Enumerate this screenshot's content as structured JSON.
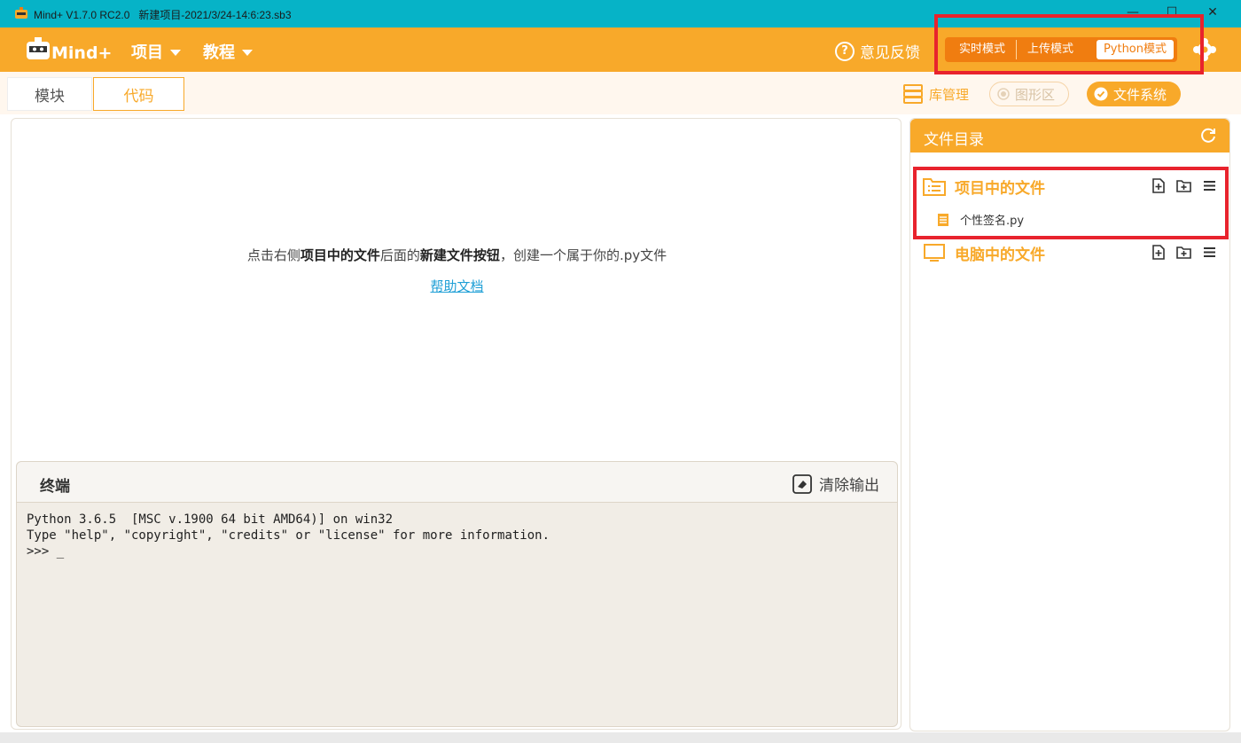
{
  "window": {
    "app_name": "Mind+ V1.7.0 RC2.0",
    "file_title": "新建项目-2021/3/24-14:6:23.sb3",
    "minimize": "—",
    "maximize": "☐",
    "close": "✕"
  },
  "appbar": {
    "menu_project": "项目",
    "menu_tutorial": "教程",
    "feedback": "意见反馈",
    "modes": [
      "实时模式",
      "上传模式",
      "Python模式"
    ]
  },
  "tabs": {
    "blocks": "模块",
    "code": "代码",
    "library": "库管理",
    "graphics": "图形区",
    "filesystem": "文件系统"
  },
  "editor": {
    "hint_prefix": "点击右侧",
    "hint_bold1": "项目中的文件",
    "hint_mid": "后面的",
    "hint_bold2": "新建文件按钮",
    "hint_suffix": "，创建一个属于你的.py文件",
    "help_link": "帮助文档"
  },
  "terminal": {
    "title": "终端",
    "clear": "清除输出",
    "lines": [
      "Python 3.6.5  [MSC v.1900 64 bit AMD64)] on win32",
      "Type \"help\", \"copyright\", \"credits\" or \"license\" for more information.",
      ">>> _"
    ]
  },
  "files": {
    "title": "文件目录",
    "project_files": "项目中的文件",
    "computer_files": "电脑中的文件",
    "items": [
      "个性签名.py"
    ]
  },
  "colors": {
    "accent": "#f8a92a",
    "titlebar": "#06b3c7",
    "highlight": "#e8232d"
  }
}
